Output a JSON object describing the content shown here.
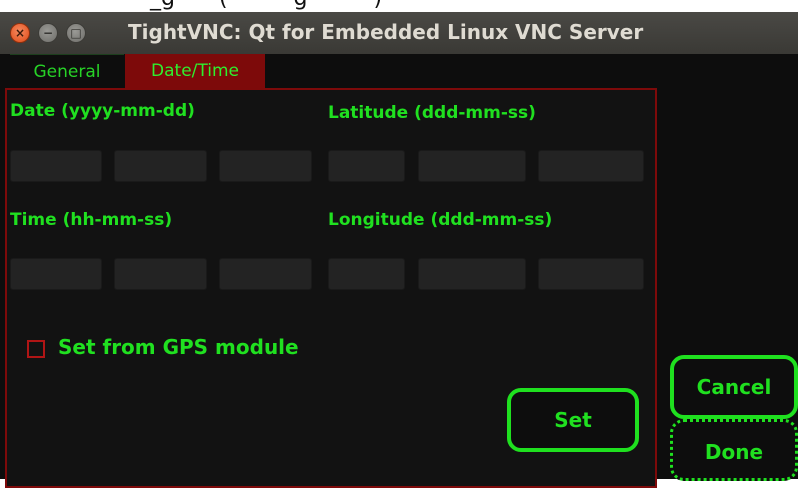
{
  "clipped_top_text": "_g  (   g   )",
  "window": {
    "title": "TightVNC: Qt for Embedded Linux VNC Server",
    "close_glyph": "×",
    "minimize_glyph": "−",
    "maximize_glyph": "□"
  },
  "tabs": [
    {
      "label": "General",
      "active": false
    },
    {
      "label": "Date/Time",
      "active": true
    }
  ],
  "form": {
    "date_label": "Date (yyyy-mm-dd)",
    "latitude_label": "Latitude (ddd-mm-ss)",
    "time_label": "Time (hh-mm-ss)",
    "longitude_label": "Longitude (ddd-mm-ss)",
    "date_fields": [
      "",
      "",
      ""
    ],
    "latitude_fields": [
      "",
      "",
      ""
    ],
    "time_fields": [
      "",
      "",
      ""
    ],
    "longitude_fields": [
      "",
      "",
      ""
    ],
    "gps_checkbox_label": "Set from GPS module",
    "gps_checked": false
  },
  "buttons": {
    "set": "Set",
    "cancel": "Cancel",
    "done": "Done"
  },
  "colors": {
    "accent_green": "#20e020",
    "tab_active_bg": "#7d0a0a",
    "panel_border": "#7d0a0a",
    "background": "#0d0d0d"
  }
}
